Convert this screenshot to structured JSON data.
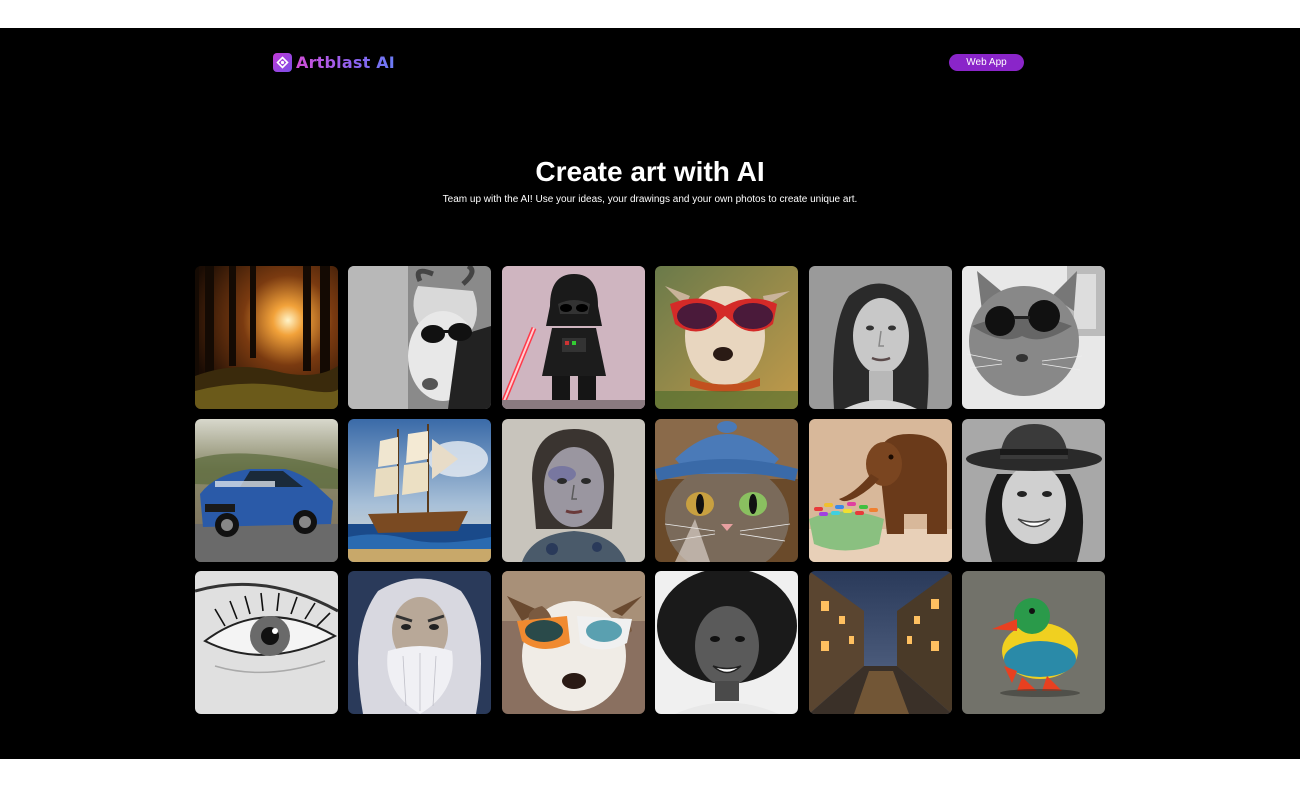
{
  "nav": {
    "logo_text": "Artblast AI",
    "web_app_label": "Web App"
  },
  "hero": {
    "title": "Create art with AI",
    "subtitle": "Team up with the AI! Use your ideas, your drawings and your own photos to create unique art."
  },
  "colors": {
    "accent": "#8a25c9",
    "background": "#000000"
  },
  "gallery": [
    {
      "subject": "sunset-forest"
    },
    {
      "subject": "goat-sunglasses"
    },
    {
      "subject": "darth-vader-figure"
    },
    {
      "subject": "dog-red-sunglasses"
    },
    {
      "subject": "woman-portrait-bw"
    },
    {
      "subject": "cat-sunglasses-bw"
    },
    {
      "subject": "blue-mustang-car"
    },
    {
      "subject": "sailing-ship"
    },
    {
      "subject": "painted-girl"
    },
    {
      "subject": "cat-blue-hat"
    },
    {
      "subject": "wooden-elephant-candy"
    },
    {
      "subject": "woman-hat-bw"
    },
    {
      "subject": "eye-lashes-bw"
    },
    {
      "subject": "old-wizard-man"
    },
    {
      "subject": "dog-goggles"
    },
    {
      "subject": "woman-afro-bw"
    },
    {
      "subject": "night-street"
    },
    {
      "subject": "rubber-duck"
    }
  ]
}
